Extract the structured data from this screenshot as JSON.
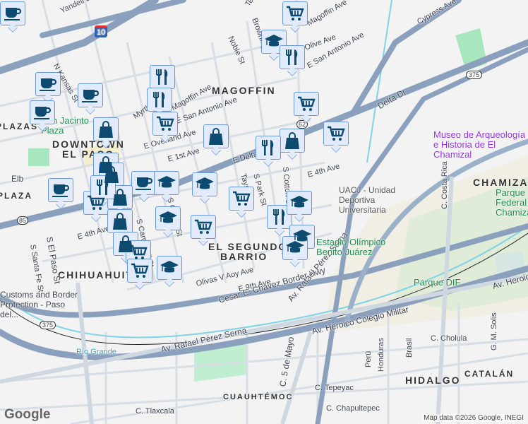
{
  "map": {
    "neighborhoods": [
      "MAGOFFIN",
      "DOWNTOWN",
      "EL PASO",
      "EL SEGUNDO",
      "BARRIO",
      "CHIHUAHUITA",
      "CHAMIZAL",
      "HIDALGO",
      "CATALÁN",
      "CUAUHTÉMOC",
      "PLAZAS",
      "PLAZA"
    ],
    "streets": [
      "Yandell Dr",
      "N Kansas St",
      "Myrtle Ave",
      "Magoffin Ave",
      "E San Antonio Ave",
      "E Overland Ave",
      "E 1st Ave",
      "E Delta Dr",
      "Tays St",
      "S Park St",
      "S Cotton St",
      "E 4th Ave",
      "E 4th Ave",
      "S Ochoa St",
      "S Campbell St",
      "S El Paso St",
      "S Santa Fe St",
      "Olivas V Aoy Ave",
      "E 9th Ave",
      "Cesar E. Chavez Border Hwy",
      "Av. Rafael Pérez Serna",
      "Av. Rafael Pérez Serna",
      "Av. Heroico Colegio Militar",
      "Av. Heroico",
      "Delta Dr",
      "Cypress Ave",
      "Noble St",
      "Olive Ave",
      "Magoffin Ave",
      "E San Antonio Ave",
      "C. Costa Rica",
      "C. 5 de Mayo",
      "C. Tepeyac",
      "C. Chapultepec",
      "C. Cholula",
      "C. Tlaxcala",
      "Honduras",
      "Brasil",
      "Perú",
      "G. M. Solis",
      "Texas Ave",
      "Browning"
    ],
    "shields": [
      "10",
      "375",
      "375",
      "62",
      "85"
    ],
    "parks": [
      "San Jacinto Plaza",
      "Parque DIF",
      "Parque Federal Chamizal",
      "Estadio Olímpico Benito Juárez",
      "UACJ - Unidad Deportiva Universitaria"
    ],
    "places": [
      "Museo de Arqueología e Historia de El Chamizal",
      "Customs and Border Protection - Paso del...",
      "Río Grande",
      "Elb"
    ],
    "attribution": "Map data ©2026 Google, INEGI",
    "logo": "Google"
  },
  "markers": [
    "coffee",
    "coffee",
    "coffee",
    "coffee",
    "restaurant",
    "restaurant",
    "shopping",
    "cart",
    "cart",
    "school",
    "restaurant",
    "cart",
    "shopping",
    "shopping",
    "restaurant",
    "cart",
    "coffee",
    "shopping",
    "shopping",
    "coffee",
    "school",
    "school",
    "cart",
    "cart",
    "shopping",
    "shopping",
    "school",
    "cart",
    "restaurant",
    "school",
    "school",
    "school",
    "shopping",
    "cart",
    "cart",
    "school",
    "restaurant"
  ],
  "colors": {
    "highway": "#8aa0bd",
    "road": "#d5dde6",
    "water": "#7fd3e8",
    "park": "#a8e6c0",
    "marker_bg": "#e2ebfb",
    "marker_border": "#6b97dd",
    "icon": "#0d4a70"
  }
}
